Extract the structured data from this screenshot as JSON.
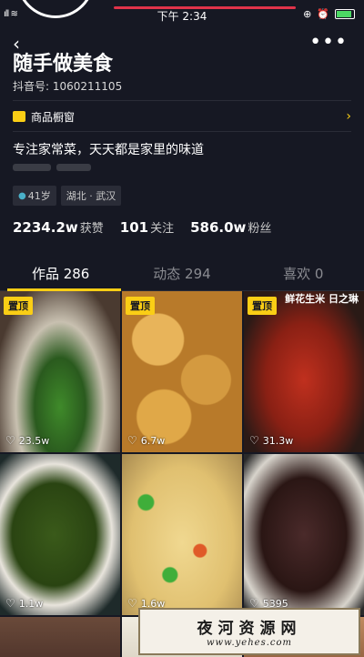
{
  "status_bar": {
    "time": "下午 2:34",
    "signal": "ıll ≋"
  },
  "header": {
    "back_icon": "‹",
    "more_icon": "•••"
  },
  "profile": {
    "name": "随手做美食",
    "douyin_id": "抖音号: 1060211105",
    "shop_label": "商品橱窗",
    "shop_arrow": "›",
    "bio": "专注家常菜，天天都是家里的味道",
    "age_tag": "41岁",
    "location_tag": "湖北 · 武汉"
  },
  "stats": [
    {
      "value": "2234.2w",
      "label": "获赞"
    },
    {
      "value": "101",
      "label": "关注"
    },
    {
      "value": "586.0w",
      "label": "粉丝"
    }
  ],
  "tabs": [
    {
      "label": "作品 286"
    },
    {
      "label": "动态 294"
    },
    {
      "label": "喜欢 0"
    }
  ],
  "videos": [
    {
      "pin": "置顶",
      "likes": "23.5w"
    },
    {
      "pin": "置顶",
      "likes": "6.7w"
    },
    {
      "pin": "置顶",
      "likes": "31.3w",
      "overlay_text": "鲜花生米 日之琳"
    },
    {
      "pin": "",
      "likes": "1.1w"
    },
    {
      "pin": "",
      "likes": "1.6w"
    },
    {
      "pin": "",
      "likes": "5395"
    }
  ],
  "heart_icon": "♡",
  "watermark": {
    "title": "夜河资源网",
    "url": "www.yehes.com"
  },
  "colors": {
    "background": "#161823",
    "accent_yellow": "#face15",
    "status_red": "#e0334a"
  }
}
